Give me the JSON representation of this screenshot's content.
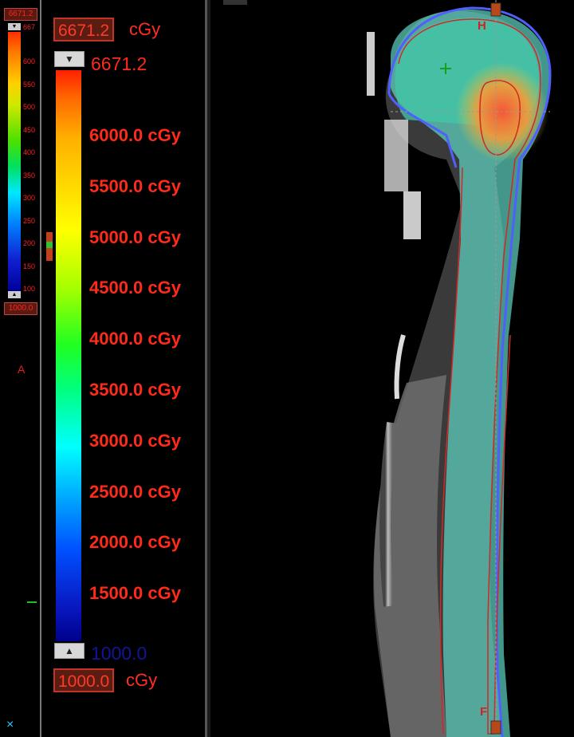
{
  "mini_panel": {
    "max_value": "6671.2",
    "top_tick": "667",
    "ticks": [
      "600",
      "550",
      "500",
      "450",
      "400",
      "350",
      "300",
      "250",
      "200",
      "150",
      "100"
    ],
    "min_value": "1000.0",
    "orientation_label": "A",
    "close_glyph": "×"
  },
  "colorbar": {
    "max_value": "6671.2",
    "max_unit": "cGy",
    "range_top_label": "6671.2",
    "range_bottom_label": "1000.0",
    "min_value": "1000.0",
    "min_unit": "cGy",
    "tick_labels": [
      "6000.0 cGy",
      "5500.0 cGy",
      "5000.0 cGy",
      "4500.0 cGy",
      "4000.0 cGy",
      "3500.0 cGy",
      "3000.0 cGy",
      "2500.0 cGy",
      "2000.0 cGy",
      "1500.0 cGy"
    ],
    "up_arrow": "▲",
    "down_arrow": "▼"
  },
  "viewport": {
    "head_marker": "H",
    "foot_marker": "F"
  },
  "colors": {
    "label_red": "#ff2a1a",
    "box_fill": "#5b1d12",
    "dose_high": "#ff4020",
    "dose_low": "#00008a",
    "contour_red": "#d22828",
    "contour_blue": "#5060ff"
  }
}
